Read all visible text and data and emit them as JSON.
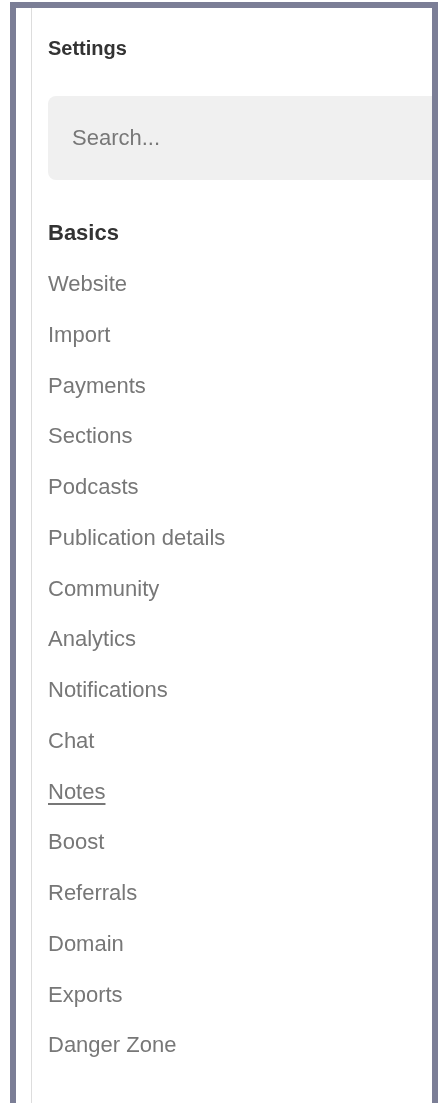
{
  "title": "Settings",
  "search": {
    "placeholder": "Search..."
  },
  "nav": [
    {
      "label": "Basics",
      "selected": true,
      "underlined": false
    },
    {
      "label": "Website",
      "selected": false,
      "underlined": false
    },
    {
      "label": "Import",
      "selected": false,
      "underlined": false
    },
    {
      "label": "Payments",
      "selected": false,
      "underlined": false
    },
    {
      "label": "Sections",
      "selected": false,
      "underlined": false
    },
    {
      "label": "Podcasts",
      "selected": false,
      "underlined": false
    },
    {
      "label": "Publication details",
      "selected": false,
      "underlined": false
    },
    {
      "label": "Community",
      "selected": false,
      "underlined": false
    },
    {
      "label": "Analytics",
      "selected": false,
      "underlined": false
    },
    {
      "label": "Notifications",
      "selected": false,
      "underlined": false
    },
    {
      "label": "Chat",
      "selected": false,
      "underlined": false
    },
    {
      "label": "Notes",
      "selected": false,
      "underlined": true
    },
    {
      "label": "Boost",
      "selected": false,
      "underlined": false
    },
    {
      "label": "Referrals",
      "selected": false,
      "underlined": false
    },
    {
      "label": "Domain",
      "selected": false,
      "underlined": false
    },
    {
      "label": "Exports",
      "selected": false,
      "underlined": false
    },
    {
      "label": "Danger Zone",
      "selected": false,
      "underlined": false
    }
  ]
}
